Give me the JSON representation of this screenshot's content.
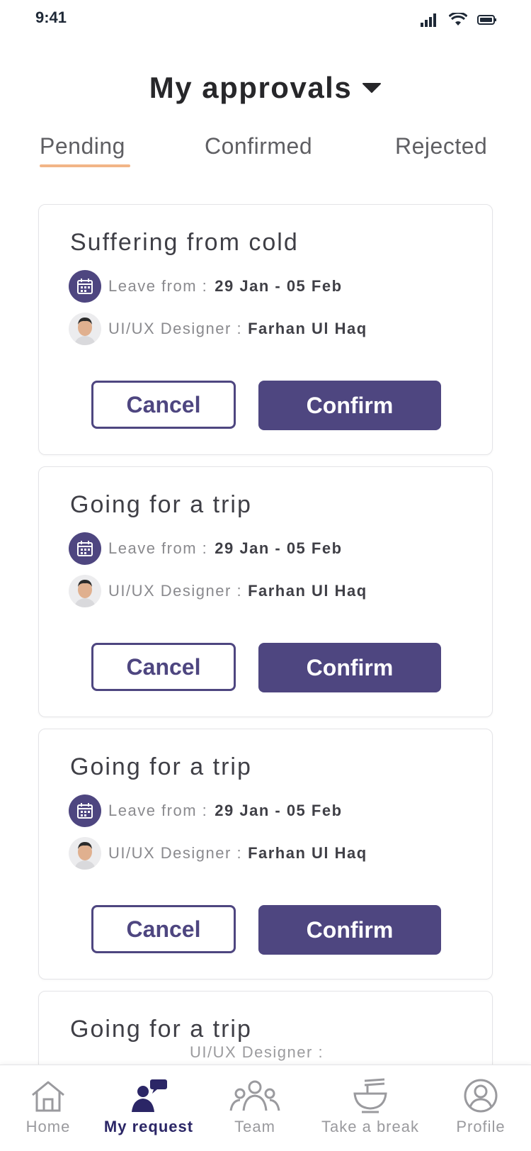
{
  "status_bar": {
    "time": "9:41"
  },
  "header": {
    "title": "My approvals"
  },
  "tabs": [
    {
      "label": "Pending",
      "active": true
    },
    {
      "label": "Confirmed",
      "active": false
    },
    {
      "label": "Rejected",
      "active": false
    }
  ],
  "colors": {
    "accent": "#4e4680",
    "tab_underline": "#f2b587",
    "nav_active": "#2b2666"
  },
  "cards": [
    {
      "title": "Suffering from cold",
      "date_label": "Leave from :",
      "date_value": "29 Jan - 05 Feb",
      "person_label": "UI/UX Designer :",
      "person_name": "Farhan Ul Haq",
      "cancel_label": "Cancel",
      "confirm_label": "Confirm"
    },
    {
      "title": "Going for a trip",
      "date_label": "Leave from :",
      "date_value": "29 Jan - 05 Feb",
      "person_label": "UI/UX Designer :",
      "person_name": "Farhan Ul Haq",
      "cancel_label": "Cancel",
      "confirm_label": "Confirm"
    },
    {
      "title": "Going for a trip",
      "date_label": "Leave from :",
      "date_value": "29 Jan - 05 Feb",
      "person_label": "UI/UX Designer :",
      "person_name": "Farhan Ul Haq",
      "cancel_label": "Cancel",
      "confirm_label": "Confirm"
    },
    {
      "title": "Going for a trip",
      "person_label": "UI/UX Designer :"
    }
  ],
  "bottom_nav": [
    {
      "label": "Home",
      "icon": "home-icon"
    },
    {
      "label": "My request",
      "icon": "chat-person-icon",
      "active": true
    },
    {
      "label": "Team",
      "icon": "team-icon"
    },
    {
      "label": "Take a break",
      "icon": "noodle-bowl-icon"
    },
    {
      "label": "Profile",
      "icon": "profile-icon"
    }
  ]
}
